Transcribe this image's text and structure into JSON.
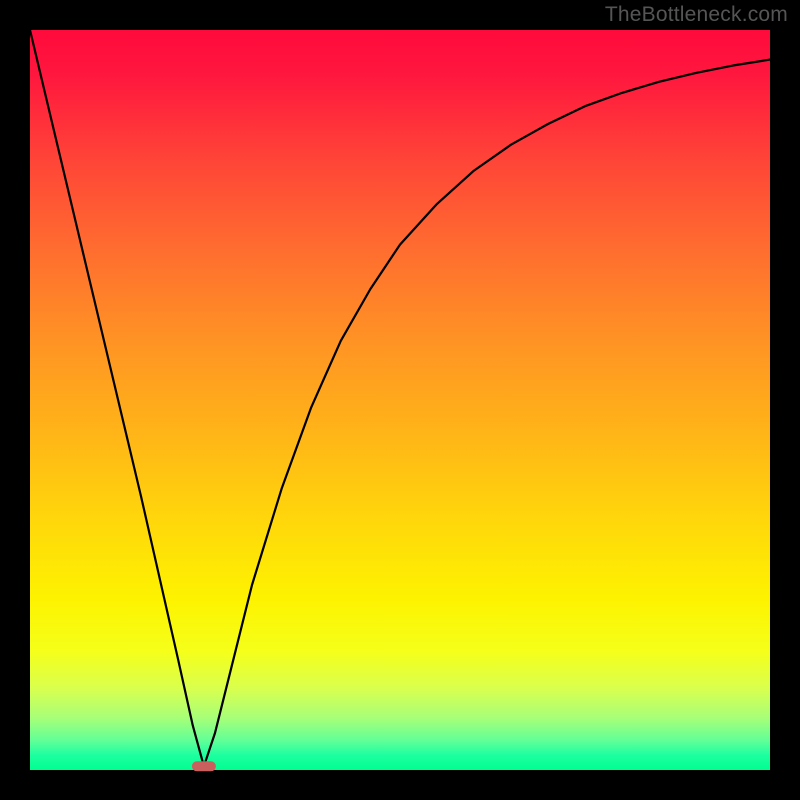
{
  "watermark": "TheBottleneck.com",
  "chart_data": {
    "type": "line",
    "title": "",
    "xlabel": "",
    "ylabel": "",
    "xlim": [
      0,
      100
    ],
    "ylim": [
      0,
      100
    ],
    "grid": false,
    "legend": false,
    "marker": {
      "x": 23.5,
      "y": 0.5
    },
    "series": [
      {
        "name": "curve",
        "x": [
          0,
          5,
          10,
          15,
          20,
          22,
          23.5,
          25,
          27,
          30,
          34,
          38,
          42,
          46,
          50,
          55,
          60,
          65,
          70,
          75,
          80,
          85,
          90,
          95,
          100
        ],
        "y": [
          100,
          79,
          58,
          37,
          15,
          6,
          0.5,
          5,
          13,
          25,
          38,
          49,
          58,
          65,
          71,
          76.5,
          81,
          84.5,
          87.3,
          89.7,
          91.5,
          93,
          94.2,
          95.2,
          96
        ]
      }
    ]
  }
}
